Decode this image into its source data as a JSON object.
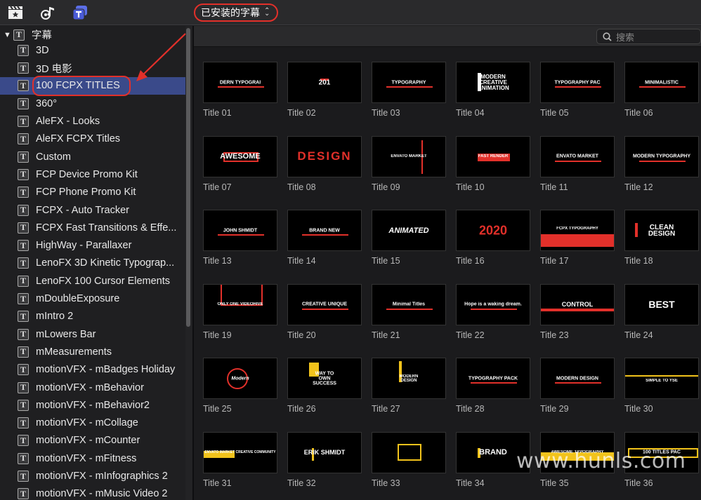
{
  "toolbar": {
    "dropdown_label": "已安装的字幕",
    "icons": [
      "clapper-star-icon",
      "music-camera-icon",
      "titles-icon"
    ]
  },
  "search": {
    "placeholder": "搜索"
  },
  "sidebar": {
    "root_label": "字幕",
    "items": [
      {
        "label": "3D"
      },
      {
        "label": "3D 电影"
      },
      {
        "label": "100 FCPX TITLES",
        "selected": true
      },
      {
        "label": "360°"
      },
      {
        "label": "AleFX - Looks"
      },
      {
        "label": "AleFX FCPX Titles"
      },
      {
        "label": "Custom"
      },
      {
        "label": "FCP Device Promo Kit"
      },
      {
        "label": "FCP Phone Promo Kit"
      },
      {
        "label": "FCPX - Auto Tracker"
      },
      {
        "label": "FCPX Fast Transitions & Effe..."
      },
      {
        "label": "HighWay - Parallaxer"
      },
      {
        "label": "LenoFX 3D Kinetic Typograp..."
      },
      {
        "label": "LenoFX 100 Cursor Elements"
      },
      {
        "label": "mDoubleExposure"
      },
      {
        "label": "mIntro 2"
      },
      {
        "label": "mLowers Bar"
      },
      {
        "label": "mMeasurements"
      },
      {
        "label": "motionVFX - mBadges Holiday"
      },
      {
        "label": "motionVFX - mBehavior"
      },
      {
        "label": "motionVFX - mBehavior2"
      },
      {
        "label": "motionVFX - mCollage"
      },
      {
        "label": "motionVFX - mCounter"
      },
      {
        "label": "motionVFX - mFitness"
      },
      {
        "label": "motionVFX - mInfographics 2"
      },
      {
        "label": "motionVFX - mMusic Video 2"
      }
    ]
  },
  "tiles": [
    {
      "label": "Title 01",
      "text": "DERN TYPOGRAI"
    },
    {
      "label": "Title 02",
      "text": "201"
    },
    {
      "label": "Title 03",
      "text": "TYPOGRAPHY"
    },
    {
      "label": "Title 04",
      "text": "MODERN CREATIVE ANIMATION"
    },
    {
      "label": "Title 05",
      "text": "TYPOGRAPHY PAC"
    },
    {
      "label": "Title 06",
      "text": "MINIMALISTIC"
    },
    {
      "label": "Title 07",
      "text": "AWESOME"
    },
    {
      "label": "Title 08",
      "text": "DESIGN"
    },
    {
      "label": "Title 09",
      "text": "ENVATO MARKET"
    },
    {
      "label": "Title 10",
      "text": "FAST RENDER"
    },
    {
      "label": "Title 11",
      "text": "ENVATO MARKET"
    },
    {
      "label": "Title 12",
      "text": "MODERN TYPOGRAPHY"
    },
    {
      "label": "Title 13",
      "text": "JOHN SHMIDT"
    },
    {
      "label": "Title 14",
      "text": "BRAND NEW"
    },
    {
      "label": "Title 15",
      "text": "ANIMATED"
    },
    {
      "label": "Title 16",
      "text": "2020"
    },
    {
      "label": "Title 17",
      "text": "FCPX TYPOGRAPHY"
    },
    {
      "label": "Title 18",
      "text": "CLEAN DESIGN"
    },
    {
      "label": "Title 19",
      "text": "ONLY ONE VIDEOHIVE"
    },
    {
      "label": "Title 20",
      "text": "CREATIVE UNIQUE"
    },
    {
      "label": "Title 21",
      "text": "Minimal Titles"
    },
    {
      "label": "Title 22",
      "text": "Hope is a waking dream."
    },
    {
      "label": "Title 23",
      "text": "CONTROL"
    },
    {
      "label": "Title 24",
      "text": "BEST"
    },
    {
      "label": "Title 25",
      "text": "Modern"
    },
    {
      "label": "Title 26",
      "text": "WAY TO OWN SUCCESS"
    },
    {
      "label": "Title 27",
      "text": "MODERN DESIGN"
    },
    {
      "label": "Title 28",
      "text": "TYPOGRAPHY PACK"
    },
    {
      "label": "Title 29",
      "text": "MODERN DESIGN"
    },
    {
      "label": "Title 30",
      "text": "SIMPLE TO YSE"
    },
    {
      "label": "Title 31",
      "text": "ENVATO MARKET CREATIVE COMMUNITY"
    },
    {
      "label": "Title 32",
      "text": "ERIK SHMIDT"
    },
    {
      "label": "Title 33",
      "text": ""
    },
    {
      "label": "Title 34",
      "text": "BRAND"
    },
    {
      "label": "Title 35",
      "text": "AWESOME TYPOGRAPHY"
    },
    {
      "label": "Title 36",
      "text": "100 TITLES PAC"
    }
  ],
  "watermark": "www.hunls.com",
  "colors": {
    "accent_red": "#e2302a",
    "selection": "#3a4a8a",
    "yellow": "#f2c31b"
  }
}
